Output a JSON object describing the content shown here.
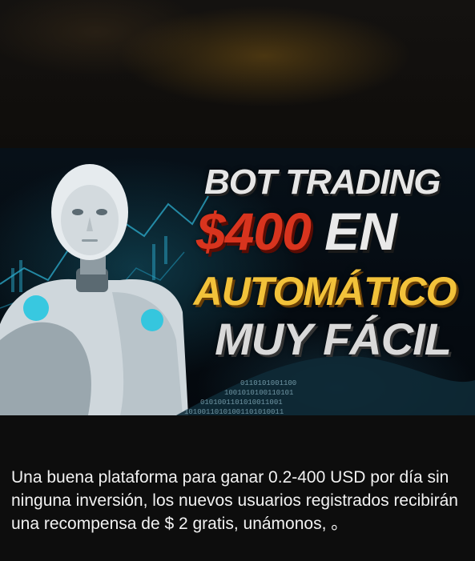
{
  "banner": {
    "line1": "BOT TRADING",
    "line2_amount": "$400",
    "line2_suffix": "EN",
    "line3": "AUTOMÁTICO",
    "line4": "MUY FÁCIL"
  },
  "post": {
    "caption": "Una buena plataforma para ganar 0.2-400 USD por día sin ninguna inversión, los nuevos usuarios registrados recibirán una recompensa de $ 2 gratis, unámonos, 。"
  },
  "colors": {
    "money": "#d8341e",
    "automatico": "#f2c23a",
    "background": "#0d0d0d"
  }
}
